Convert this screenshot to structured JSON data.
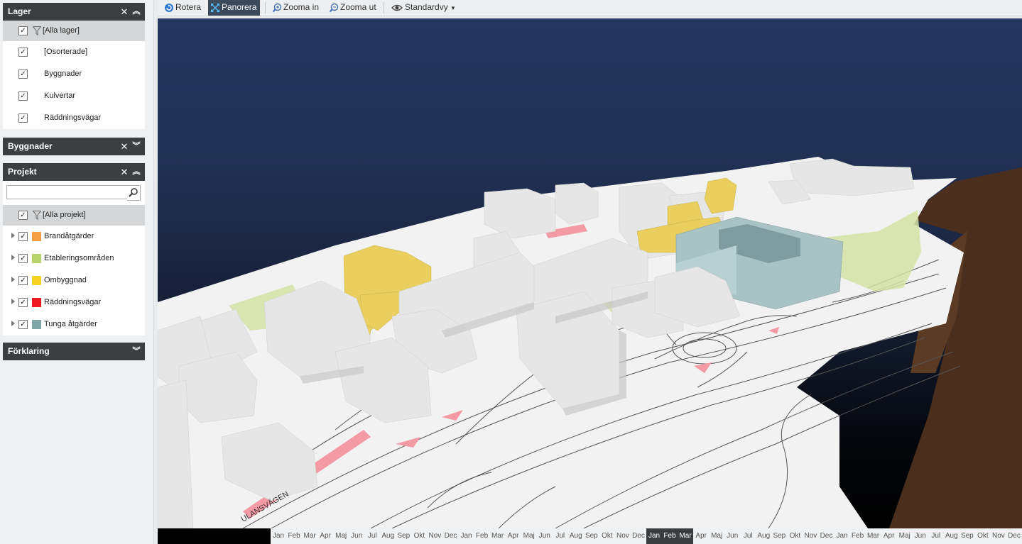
{
  "panels": {
    "lager": {
      "title": "Lager",
      "all_label": "[Alla lager]",
      "items": [
        {
          "label": "[Osorterade]"
        },
        {
          "label": "Byggnader"
        },
        {
          "label": "Kulvertar"
        },
        {
          "label": "Räddningsvägar"
        }
      ]
    },
    "byggnader": {
      "title": "Byggnader"
    },
    "projekt": {
      "title": "Projekt",
      "search_value": "",
      "all_label": "[Alla projekt]",
      "items": [
        {
          "label": "Brandåtgärder",
          "color": "#f59e44"
        },
        {
          "label": "Etableringsområden",
          "color": "#b9d36c"
        },
        {
          "label": "Ombyggnad",
          "color": "#f6d323"
        },
        {
          "label": "Räddningsvägar",
          "color": "#ef1b24"
        },
        {
          "label": "Tunga åtgärder",
          "color": "#7fa7a5"
        }
      ]
    },
    "forklaring": {
      "title": "Förklaring"
    }
  },
  "toolbar": {
    "rotate": "Rotera",
    "pan": "Panorera",
    "zoom_in": "Zooma in",
    "zoom_out": "Zooma ut",
    "view": "Standardvy"
  },
  "map": {
    "road_label": "ULANSVÄGEN"
  },
  "timeline": {
    "months": [
      "Jan",
      "Feb",
      "Mar",
      "Apr",
      "Maj",
      "Jun",
      "Jul",
      "Aug",
      "Sep",
      "Okt",
      "Nov",
      "Dec",
      "Jan",
      "Feb",
      "Mar",
      "Apr",
      "Maj",
      "Jun",
      "Jul",
      "Aug",
      "Sep",
      "Okt",
      "Nov",
      "Dec",
      "Jan",
      "Feb",
      "Mar",
      "Apr",
      "Maj",
      "Jun",
      "Jul",
      "Aug",
      "Sep",
      "Okt",
      "Nov",
      "Dec",
      "Jan",
      "Feb",
      "Mar",
      "Apr",
      "Maj",
      "Jun",
      "Jul",
      "Aug",
      "Sep",
      "Okt",
      "Nov",
      "Dec"
    ],
    "selected": [
      24,
      25,
      26
    ]
  },
  "colors": {
    "header_bg": "#3b3f42",
    "active_tool": "#3a4a5a",
    "building_white": "#e6e6e6",
    "building_yellow": "#e8cf5e",
    "building_teal": "#a9c2c4",
    "area_green": "#d5e3a6",
    "route_pink": "#f49aa4"
  }
}
